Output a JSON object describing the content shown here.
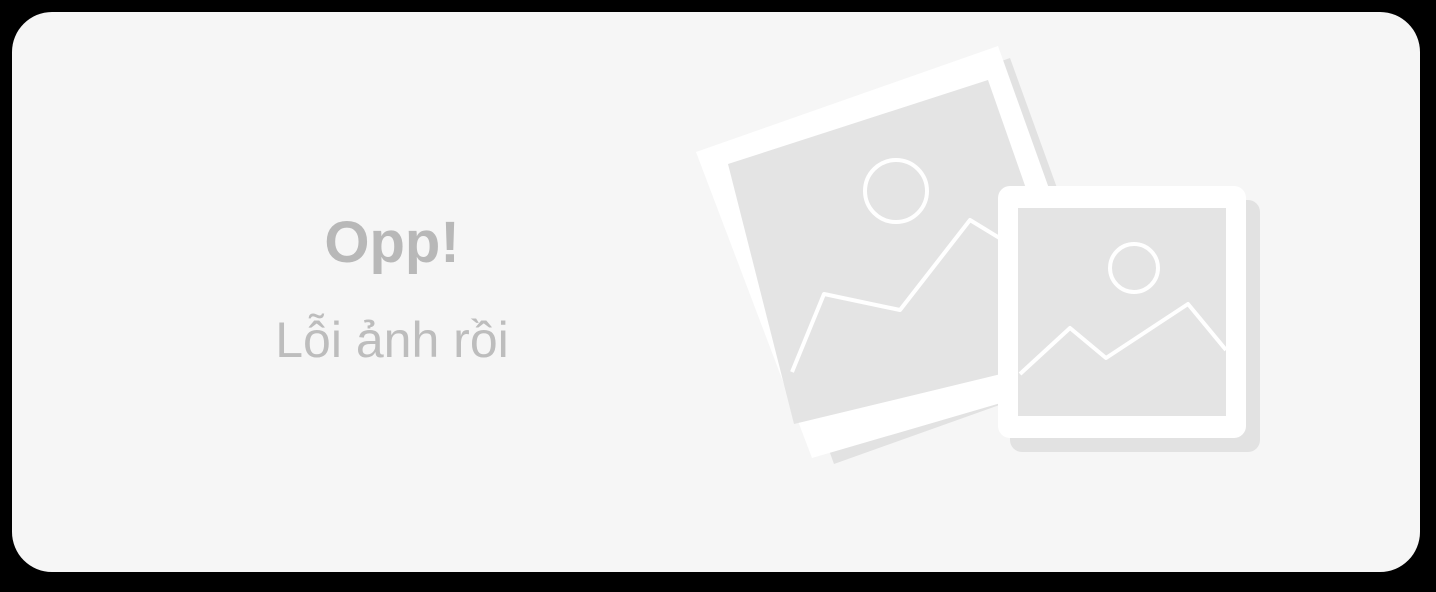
{
  "error_card": {
    "title": "Opp!",
    "message": "Lỗi ảnh rồi",
    "illustration_icon": "broken-image-icon"
  },
  "colors": {
    "background": "#f6f6f6",
    "text_title": "#b8b8b8",
    "text_message": "#bdbdbd",
    "frame": "#ffffff",
    "photo_fill": "#e4e4e4",
    "shadow": "#e0e0e0"
  }
}
